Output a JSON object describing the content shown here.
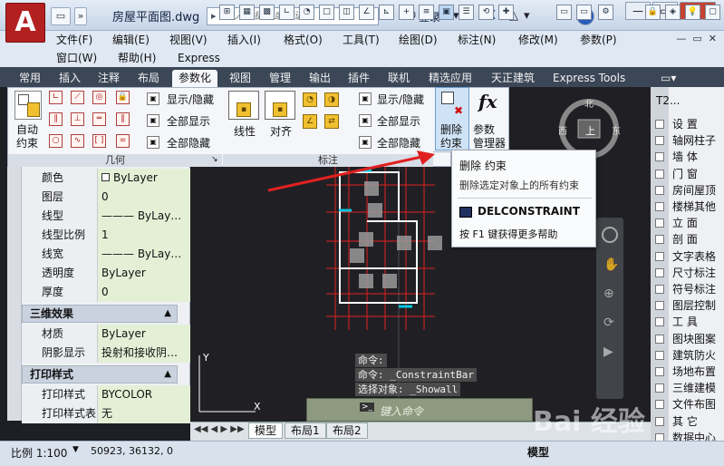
{
  "titlebar": {
    "app_logo": "A",
    "file_title": "房屋平面图.dwg",
    "search_placeholder": "键入关键字或短语",
    "login": "登录",
    "help": "?"
  },
  "menus": [
    "文件(F)",
    "编辑(E)",
    "视图(V)",
    "插入(I)",
    "格式(O)",
    "工具(T)",
    "绘图(D)",
    "标注(N)",
    "修改(M)",
    "参数(P)"
  ],
  "menus2": [
    "窗口(W)",
    "帮助(H)",
    "Express"
  ],
  "ribbon_tabs": [
    "常用",
    "插入",
    "注释",
    "布局",
    "参数化",
    "视图",
    "管理",
    "输出",
    "插件",
    "联机",
    "精选应用",
    "天正建筑",
    "Express Tools"
  ],
  "active_tab": "参数化",
  "ribbon": {
    "auto_constraint": "自动\n约束",
    "show_hide": "显示/隐藏",
    "show_all": "全部显示",
    "hide_all": "全部隐藏",
    "geometry_footer": "几何",
    "linear": "线性",
    "aligned": "对齐",
    "dim_show_hide": "显示/隐藏",
    "dim_show_all": "全部显示",
    "dim_hide_all": "全部隐藏",
    "dim_footer": "标注",
    "delete_constraint": "删除\n约束",
    "params_manager": "参数\n管理器",
    "fx": "fx"
  },
  "tooltip": {
    "title": "删除 约束",
    "desc": "删除选定对象上的所有约束",
    "command": "DELCONSTRAINT",
    "help": "按 F1 键获得更多帮助"
  },
  "viewcube": {
    "north": "北",
    "west": "西",
    "east": "东",
    "top": "上"
  },
  "properties": {
    "rows_general": [
      {
        "name": "颜色",
        "value": "ByLayer",
        "swatch": true
      },
      {
        "name": "图层",
        "value": "0"
      },
      {
        "name": "线型",
        "value": "——— ByLay…"
      },
      {
        "name": "线型比例",
        "value": "1"
      },
      {
        "name": "线宽",
        "value": "——— ByLay…"
      },
      {
        "name": "透明度",
        "value": "ByLayer"
      },
      {
        "name": "厚度",
        "value": "0"
      }
    ],
    "section_3d": "三维效果",
    "rows_3d": [
      {
        "name": "材质",
        "value": "ByLayer"
      },
      {
        "name": "阴影显示",
        "value": "投射和接收阴…"
      }
    ],
    "section_plot": "打印样式",
    "rows_plot": [
      {
        "name": "打印样式",
        "value": "BYCOLOR"
      },
      {
        "name": "打印样式表",
        "value": "无"
      }
    ]
  },
  "tool_palette": {
    "header": "T2...",
    "items": [
      "设  置",
      "轴网柱子",
      "墙  体",
      "门  窗",
      "房间屋顶",
      "楼梯其他",
      "立  面",
      "剖  面",
      "文字表格",
      "尺寸标注",
      "符号标注",
      "图层控制",
      "工  具",
      "图块图案",
      "建筑防火",
      "场地布置",
      "三维建模",
      "文件布图",
      "其  它",
      "数据中心"
    ]
  },
  "commands": {
    "line1": "命令:",
    "line2": "命令: _ConstraintBar",
    "line3": "选择对象: _Showall",
    "input_placeholder": "键入命令"
  },
  "layout_tabs": [
    "模型",
    "布局1",
    "布局2"
  ],
  "active_layout": "模型",
  "statusbar": {
    "scale": "比例 1:100",
    "coords": "50923, 36132, 0",
    "model": "模型"
  },
  "watermark": "Bai 经验"
}
